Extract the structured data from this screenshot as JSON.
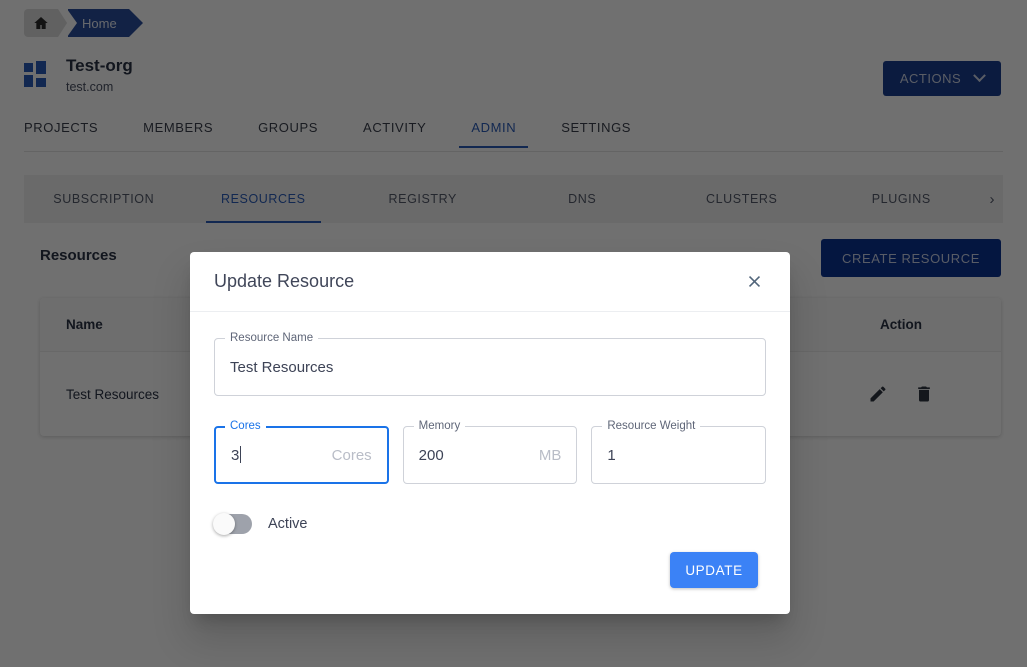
{
  "breadcrumb": {
    "home_icon": "home-icon",
    "current": "Home"
  },
  "org": {
    "name": "Test-org",
    "domain": "test.com",
    "logo_icon": "grid-logo-icon",
    "logo_color": "#2b5cb8"
  },
  "header": {
    "actions_label": "ACTIONS",
    "actions_chevron_icon": "chevron-down-icon",
    "actions_color": "#1b3f8f"
  },
  "tabs": [
    {
      "label": "PROJECTS",
      "active": false
    },
    {
      "label": "MEMBERS",
      "active": false
    },
    {
      "label": "GROUPS",
      "active": false
    },
    {
      "label": "ACTIVITY",
      "active": false
    },
    {
      "label": "ADMIN",
      "active": true
    },
    {
      "label": "SETTINGS",
      "active": false
    }
  ],
  "subtabs": {
    "items": [
      {
        "label": "SUBSCRIPTION",
        "active": false
      },
      {
        "label": "RESOURCES",
        "active": true
      },
      {
        "label": "REGISTRY",
        "active": false
      },
      {
        "label": "DNS",
        "active": false
      },
      {
        "label": "CLUSTERS",
        "active": false
      },
      {
        "label": "PLUGINS",
        "active": false
      }
    ],
    "next_arrow_icon": "chevron-right-icon",
    "next_arrow_glyph": "›",
    "accent_color": "#2b5cb8"
  },
  "main": {
    "section_title": "Resources",
    "create_button_label": "CREATE RESOURCE",
    "create_button_color": "#0b3291",
    "table": {
      "columns": [
        "Name",
        "Action"
      ],
      "rows": [
        {
          "name": "Test Resources",
          "actions": [
            "edit-icon",
            "delete-icon"
          ]
        }
      ]
    }
  },
  "dialog": {
    "title": "Update Resource",
    "close_icon": "close-icon",
    "fields": {
      "resource_name": {
        "label": "Resource Name",
        "value": "Test Resources",
        "suffix": "",
        "focused": false
      },
      "cores": {
        "label": "Cores",
        "value": "3",
        "suffix": "Cores",
        "focused": true
      },
      "memory": {
        "label": "Memory",
        "value": "200",
        "suffix": "MB",
        "focused": false
      },
      "resource_weight": {
        "label": "Resource Weight",
        "value": "1",
        "suffix": "",
        "focused": false
      }
    },
    "toggle": {
      "label": "Active",
      "state": "off"
    },
    "submit_label": "UPDATE",
    "submit_color": "#3b82f6",
    "focus_color": "#1a73e8"
  },
  "overlay": {
    "color": "rgba(0,0,0,0.56)"
  }
}
